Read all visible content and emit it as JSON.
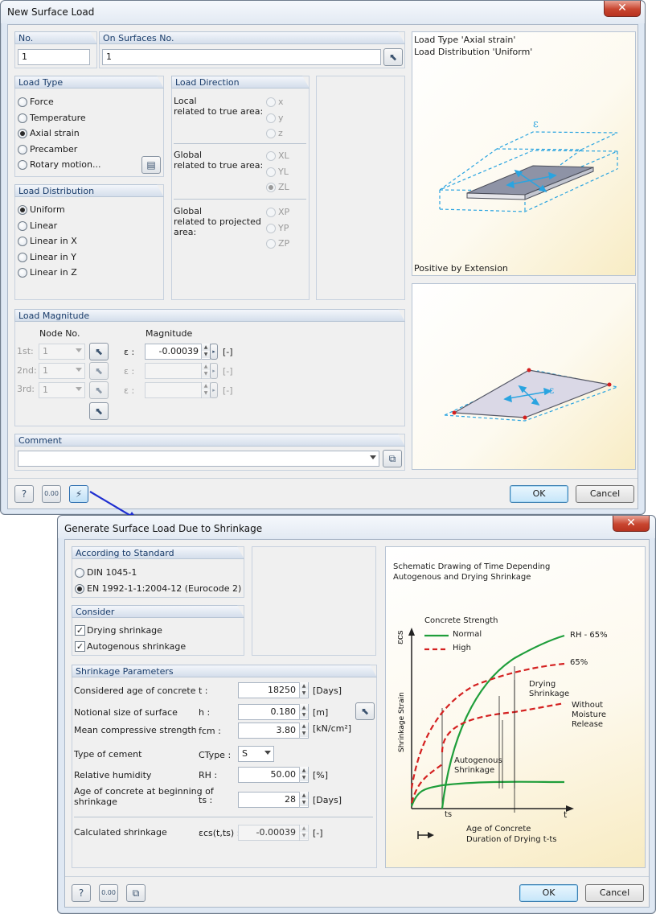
{
  "dialog1": {
    "title": "New Surface Load",
    "close": "✕",
    "no": {
      "label": "No.",
      "value": "1"
    },
    "on_surfaces": {
      "label": "On Surfaces No.",
      "value": "1"
    },
    "load_type": {
      "header": "Load Type",
      "options": [
        "Force",
        "Temperature",
        "Axial strain",
        "Precamber",
        "Rotary motion..."
      ],
      "selected": "Axial strain"
    },
    "load_direction": {
      "header": "Load Direction",
      "local_label": "Local\nrelated to true area:",
      "local_options": [
        "x",
        "y",
        "z"
      ],
      "global_label": "Global\nrelated to true area:",
      "global_options": [
        "XL",
        "YL",
        "ZL"
      ],
      "global_selected": "ZL",
      "proj_label": "Global\nrelated to projected\narea:",
      "proj_options": [
        "XP",
        "YP",
        "ZP"
      ]
    },
    "load_distribution": {
      "header": "Load Distribution",
      "options": [
        "Uniform",
        "Linear",
        "Linear in X",
        "Linear in Y",
        "Linear in Z"
      ],
      "selected": "Uniform"
    },
    "load_magnitude": {
      "header": "Load Magnitude",
      "col_node": "Node No.",
      "col_magnitude": "Magnitude",
      "rows": [
        {
          "label": "1st:",
          "node": "1",
          "symbol": "ε :",
          "value": "-0.00039",
          "unit": "[-]"
        },
        {
          "label": "2nd:",
          "node": "1",
          "symbol": "ε :",
          "value": "",
          "unit": "[-]"
        },
        {
          "label": "3rd:",
          "node": "1",
          "symbol": "ε :",
          "value": "",
          "unit": "[-]"
        }
      ]
    },
    "comment": {
      "header": "Comment",
      "value": ""
    },
    "preview_top": {
      "line1": "Load Type 'Axial strain'",
      "line2": "Load Distribution 'Uniform'",
      "footer": "Positive by Extension",
      "epsilon": "ε"
    },
    "preview_bottom": {
      "epsilon": "ε"
    },
    "ok": "OK",
    "cancel": "Cancel",
    "icons": [
      "help-icon",
      "units-icon",
      "shrinkage-generator-icon"
    ],
    "units_text": "0.00"
  },
  "dialog2": {
    "title": "Generate Surface Load Due to Shrinkage",
    "close": "✕",
    "standard": {
      "header": "According to Standard",
      "options": [
        "DIN 1045-1",
        "EN 1992-1-1:2004-12 (Eurocode 2)"
      ],
      "selected": "EN 1992-1-1:2004-12 (Eurocode 2)"
    },
    "consider": {
      "header": "Consider",
      "items": [
        {
          "label": "Drying shrinkage",
          "checked": true
        },
        {
          "label": "Autogenous shrinkage",
          "checked": true
        }
      ]
    },
    "params": {
      "header": "Shrinkage Parameters",
      "rows": [
        {
          "label": "Considered age of concrete",
          "symbol": "t :",
          "value": "18250",
          "unit": "[Days]"
        },
        {
          "label": "Notional size of surface",
          "symbol": "h :",
          "value": "0.180",
          "unit": "[m]"
        },
        {
          "label": "Mean compressive strength",
          "symbol": "fcm :",
          "value": "3.80",
          "unit": "[kN/cm²]"
        },
        {
          "label": "Type of cement",
          "symbol": "CType :",
          "value": "S",
          "unit": ""
        },
        {
          "label": "Relative humidity",
          "symbol": "RH :",
          "value": "50.00",
          "unit": "[%]"
        },
        {
          "label": "Age of concrete at beginning of\nshrinkage",
          "symbol": "ts :",
          "value": "28",
          "unit": "[Days]"
        }
      ],
      "calculated": {
        "label": "Calculated shrinkage",
        "symbol": "εcs(t,ts) :",
        "value": "-0.00039",
        "unit": "[-]"
      }
    },
    "graph": {
      "title1": "Schematic Drawing of Time Depending",
      "title2": "Autogenous and Drying Shrinkage",
      "legend_title": "Concrete Strength",
      "legend_normal": "Normal",
      "legend_high": "High",
      "y_symbol": "εcs",
      "y_label": "Shrinkage Strain",
      "rh65": "RH - 65%",
      "p65": "65%",
      "drying": "Drying\nShrinkage",
      "without": "Without\nMoisture\nRelease",
      "autogenous": "Autogenous\nShrinkage",
      "ts": "ts",
      "t": "t",
      "age1": "Age of Concrete",
      "age2": "Duration of Drying t-ts"
    },
    "ok": "OK",
    "cancel": "Cancel",
    "units_text": "0.00"
  }
}
